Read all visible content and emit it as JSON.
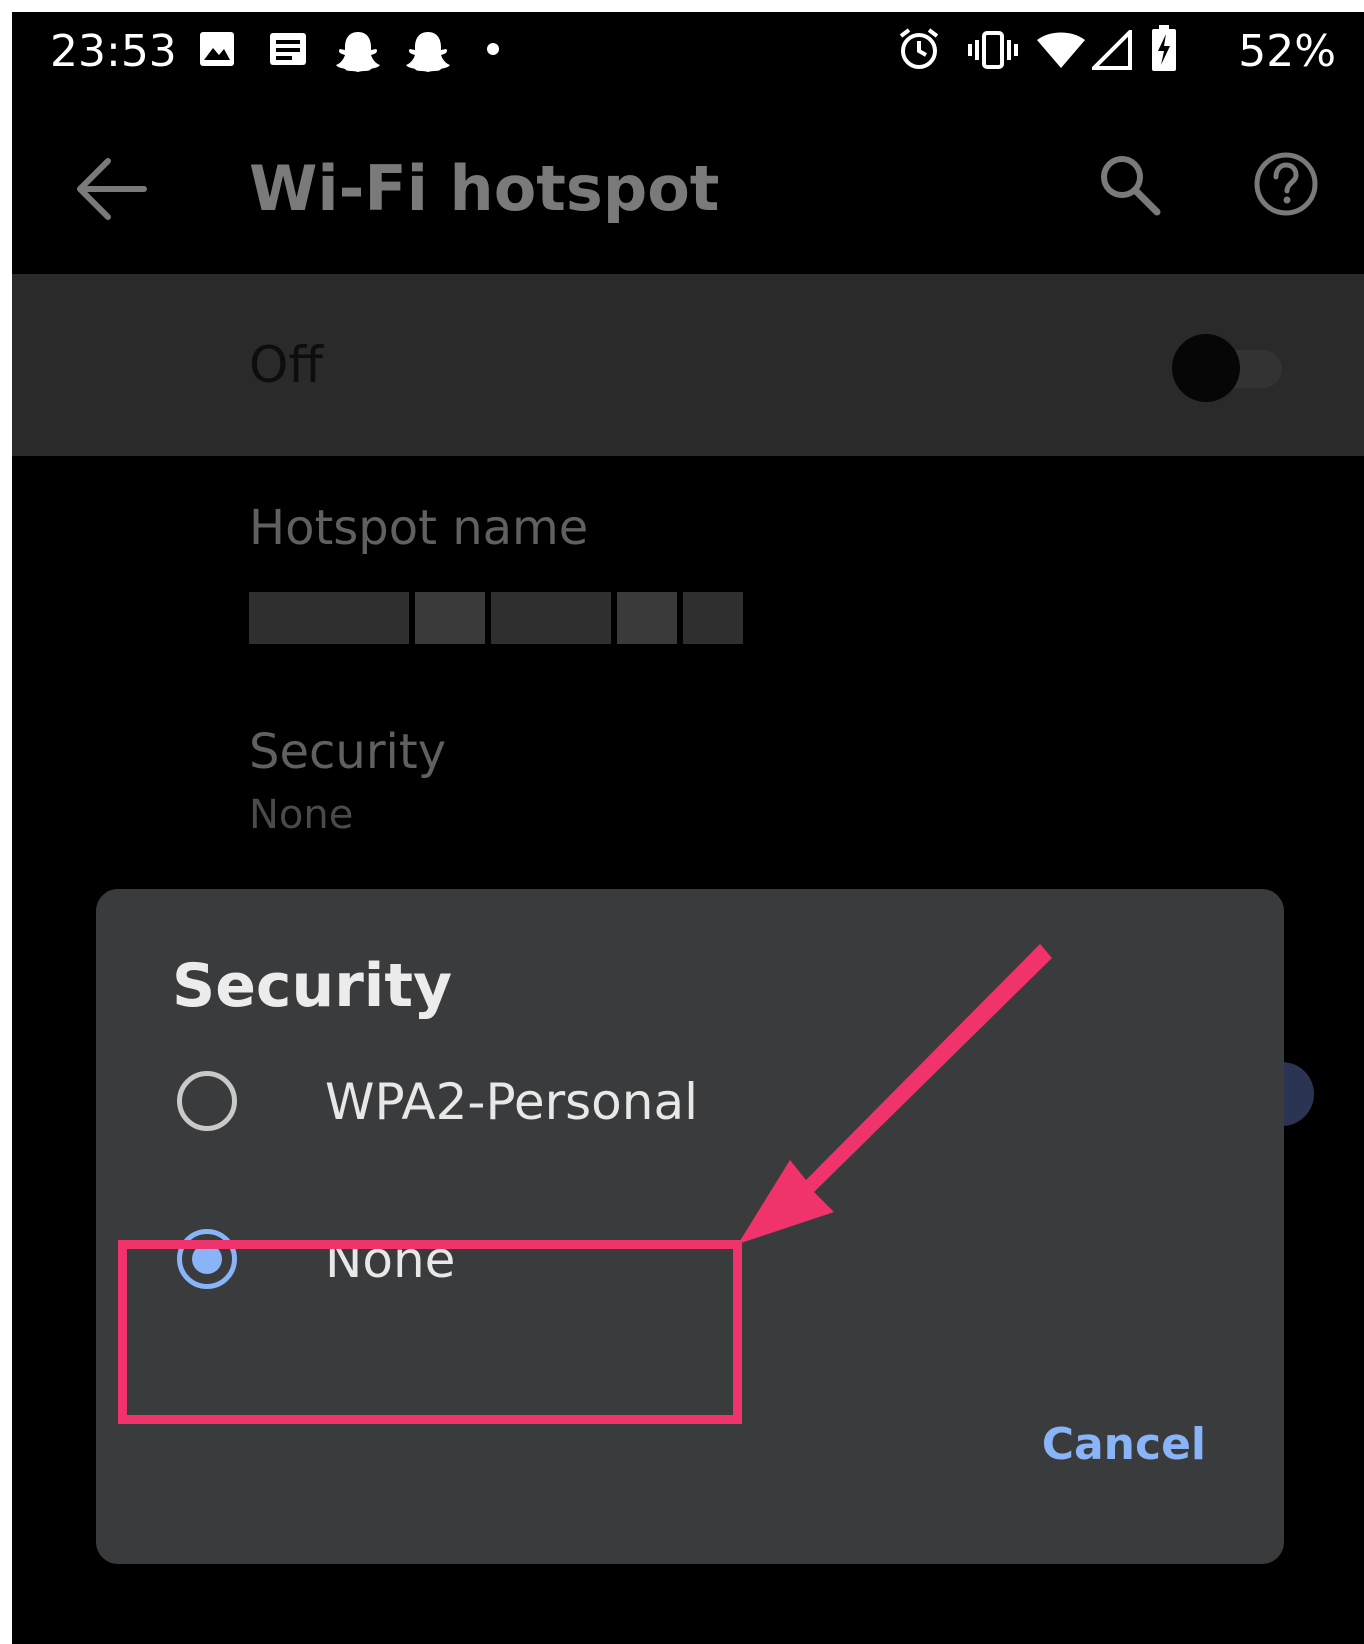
{
  "status_bar": {
    "time": "23:53",
    "battery": "52%",
    "left_icons": [
      "image-icon",
      "news-icon",
      "snapchat-icon",
      "snapchat-icon",
      "dot-icon"
    ],
    "right_icons": [
      "alarm-icon",
      "vibrate-icon",
      "wifi-icon",
      "signal-icon",
      "battery-charging-icon"
    ]
  },
  "toolbar": {
    "title": "Wi-Fi hotspot",
    "icons": [
      "back-arrow-icon",
      "search-icon",
      "help-icon"
    ]
  },
  "master_switch": {
    "label": "Off",
    "on": false
  },
  "preferences": {
    "hotspot_name": {
      "title": "Hotspot name"
    },
    "security": {
      "title": "Security",
      "summary": "None"
    }
  },
  "dialog": {
    "title": "Security",
    "options": [
      {
        "label": "WPA2-Personal",
        "selected": false
      },
      {
        "label": "None",
        "selected": true
      }
    ],
    "cancel_label": "Cancel"
  },
  "colors": {
    "accent": "#8ab4f8",
    "annotation": "#f0346b",
    "dialog_bg": "#3a3b3d",
    "switch_row_bg": "#2a2a2a"
  }
}
